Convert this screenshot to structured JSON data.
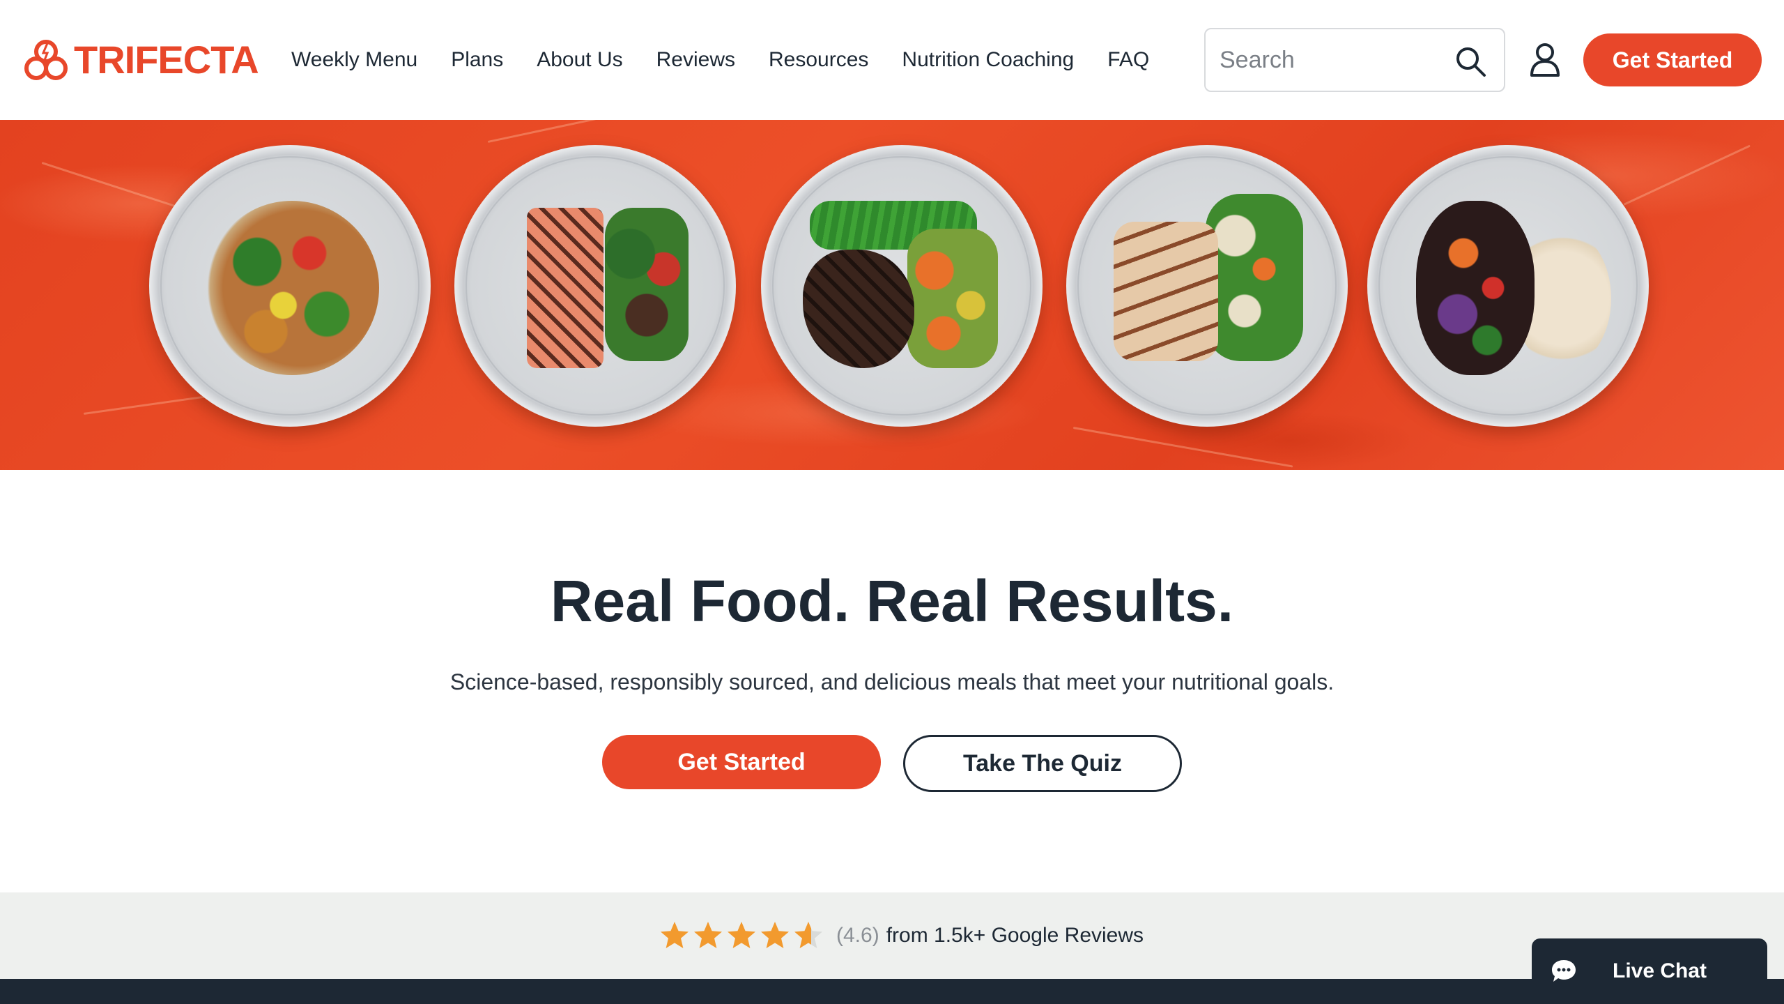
{
  "brand": {
    "name": "TRIFECTA",
    "accent_color": "#e8472a",
    "dark_color": "#1d2834"
  },
  "nav": {
    "items": [
      {
        "label": "Weekly Menu"
      },
      {
        "label": "Plans"
      },
      {
        "label": "About Us"
      },
      {
        "label": "Reviews"
      },
      {
        "label": "Resources"
      },
      {
        "label": "Nutrition Coaching"
      },
      {
        "label": "FAQ"
      }
    ]
  },
  "search": {
    "placeholder": "Search",
    "icon": "search-icon"
  },
  "account": {
    "icon": "user-icon"
  },
  "header_cta": {
    "label": "Get Started"
  },
  "hero": {
    "image": "five plates of prepared meals on an orange marble surface",
    "plates": [
      {
        "name": "plate-chicken-stir-fry"
      },
      {
        "name": "plate-grilled-salmon"
      },
      {
        "name": "plate-grilled-steak"
      },
      {
        "name": "plate-grilled-chicken"
      },
      {
        "name": "plate-vegan-rice-beans"
      }
    ]
  },
  "main": {
    "headline": "Real Food. Real Results.",
    "subheadline": "Science-based, responsibly sourced, and delicious meals that meet your nutritional goals.",
    "primary_button": "Get Started",
    "secondary_button": "Take The Quiz"
  },
  "rating": {
    "stars_value": 4.6,
    "stars_max": 5,
    "score_text": "(4.6)",
    "source_text": "from 1.5k+ Google Reviews",
    "star_color": "#f29a2e"
  },
  "live_chat": {
    "label": "Live Chat",
    "icon": "chat-bubble-icon"
  }
}
